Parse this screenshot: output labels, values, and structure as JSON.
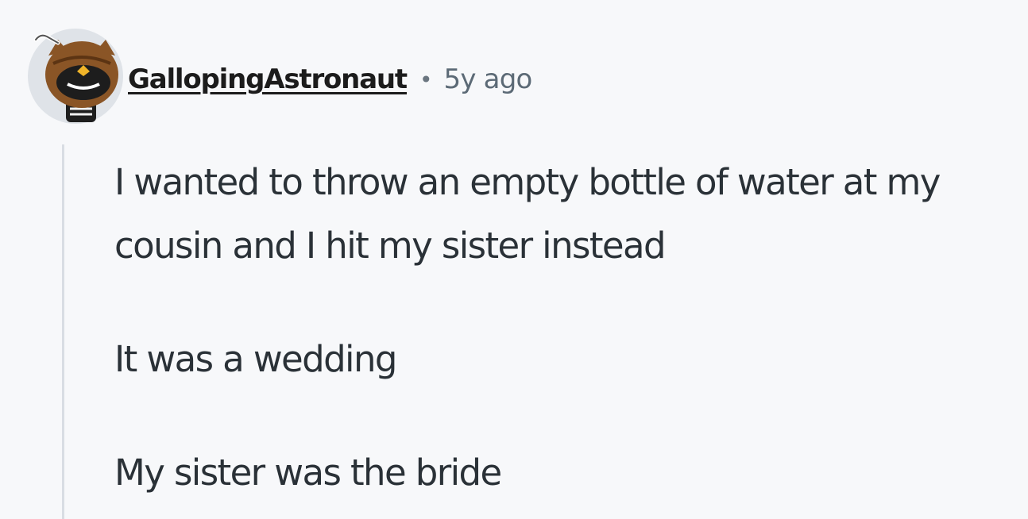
{
  "comment": {
    "author": "GallopingAstronaut",
    "separator": "•",
    "timestamp": "5y ago",
    "avatar_icon": "owl-avatar-icon",
    "paragraphs": [
      "I wanted to throw an empty bottle of water at my cousin and I hit my sister instead",
      "It was a wedding",
      "My sister was the bride"
    ]
  },
  "colors": {
    "background": "#f7f8fa",
    "text": "#2a3137",
    "username": "#1c1c1c",
    "meta": "#5c6a76",
    "thread_line": "#d9dde3"
  }
}
